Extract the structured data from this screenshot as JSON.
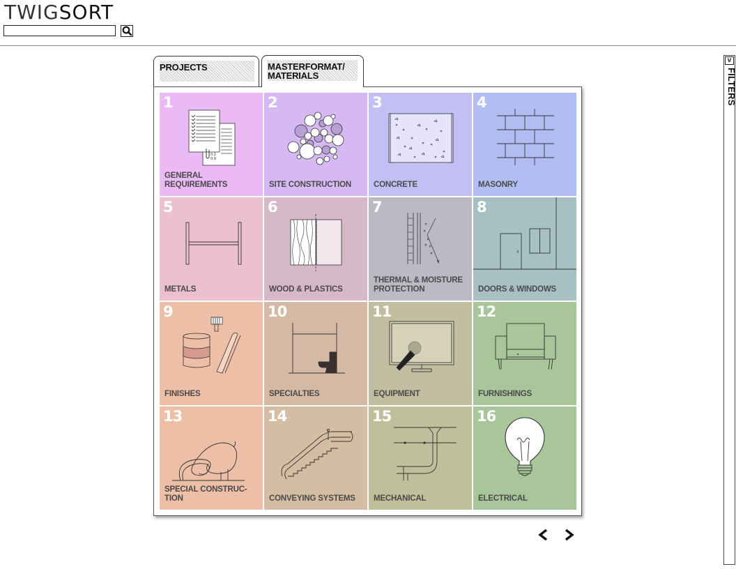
{
  "logo": {
    "part1": "TWIG",
    "part2": "SORT"
  },
  "search": {
    "value": "",
    "placeholder": ""
  },
  "tabs": [
    {
      "label": "PROJECTS",
      "active": false
    },
    {
      "label": "MASTERFORMAT/ MATERIALS",
      "active": true
    }
  ],
  "tiles": [
    {
      "number": "1",
      "label": "GENERAL REQUIREMENTS",
      "color": "#ebb9f5",
      "icon": "documents-icon"
    },
    {
      "number": "2",
      "label": "SITE CONSTRUCTION",
      "color": "#d6b9f3",
      "icon": "aggregate-icon"
    },
    {
      "number": "3",
      "label": "CONCRETE",
      "color": "#c2bff5",
      "icon": "concrete-slab-icon"
    },
    {
      "number": "4",
      "label": "MASONRY",
      "color": "#b2bef3",
      "icon": "brick-wall-icon"
    },
    {
      "number": "5",
      "label": "METALS",
      "color": "#ebc0cf",
      "icon": "i-beam-icon"
    },
    {
      "number": "6",
      "label": "WOOD & PLASTICS",
      "color": "#d7b8c8",
      "icon": "wood-panel-icon"
    },
    {
      "number": "7",
      "label": "THERMAL & MOISTURE PROTECTION",
      "color": "#bcb9c4",
      "icon": "wall-section-icon"
    },
    {
      "number": "8",
      "label": "DOORS & WINDOWS",
      "color": "#a7c0c3",
      "icon": "door-window-icon"
    },
    {
      "number": "9",
      "label": "FINISHES",
      "color": "#edbfa7",
      "icon": "paint-roll-icon"
    },
    {
      "number": "10",
      "label": "SPECIALTIES",
      "color": "#d4b9a4",
      "icon": "toilet-stall-icon"
    },
    {
      "number": "11",
      "label": "EQUIPMENT",
      "color": "#c0bda1",
      "icon": "monitor-microphone-icon"
    },
    {
      "number": "12",
      "label": "FURNISHINGS",
      "color": "#a9c59a",
      "icon": "armchair-icon"
    },
    {
      "number": "13",
      "label": "SPECIAL CONSTRUC- TION",
      "color": "#edbfa7",
      "icon": "special-structure-icon"
    },
    {
      "number": "14",
      "label": "CONVEYING SYSTEMS",
      "color": "#d4bda3",
      "icon": "escalator-icon"
    },
    {
      "number": "15",
      "label": "MECHANICAL",
      "color": "#c0bf9c",
      "icon": "ductwork-icon"
    },
    {
      "number": "16",
      "label": "ELECTRICAL",
      "color": "#a9c59a",
      "icon": "light-bulb-icon"
    }
  ],
  "filters": {
    "label": "FILTERS",
    "chevron": "v"
  }
}
